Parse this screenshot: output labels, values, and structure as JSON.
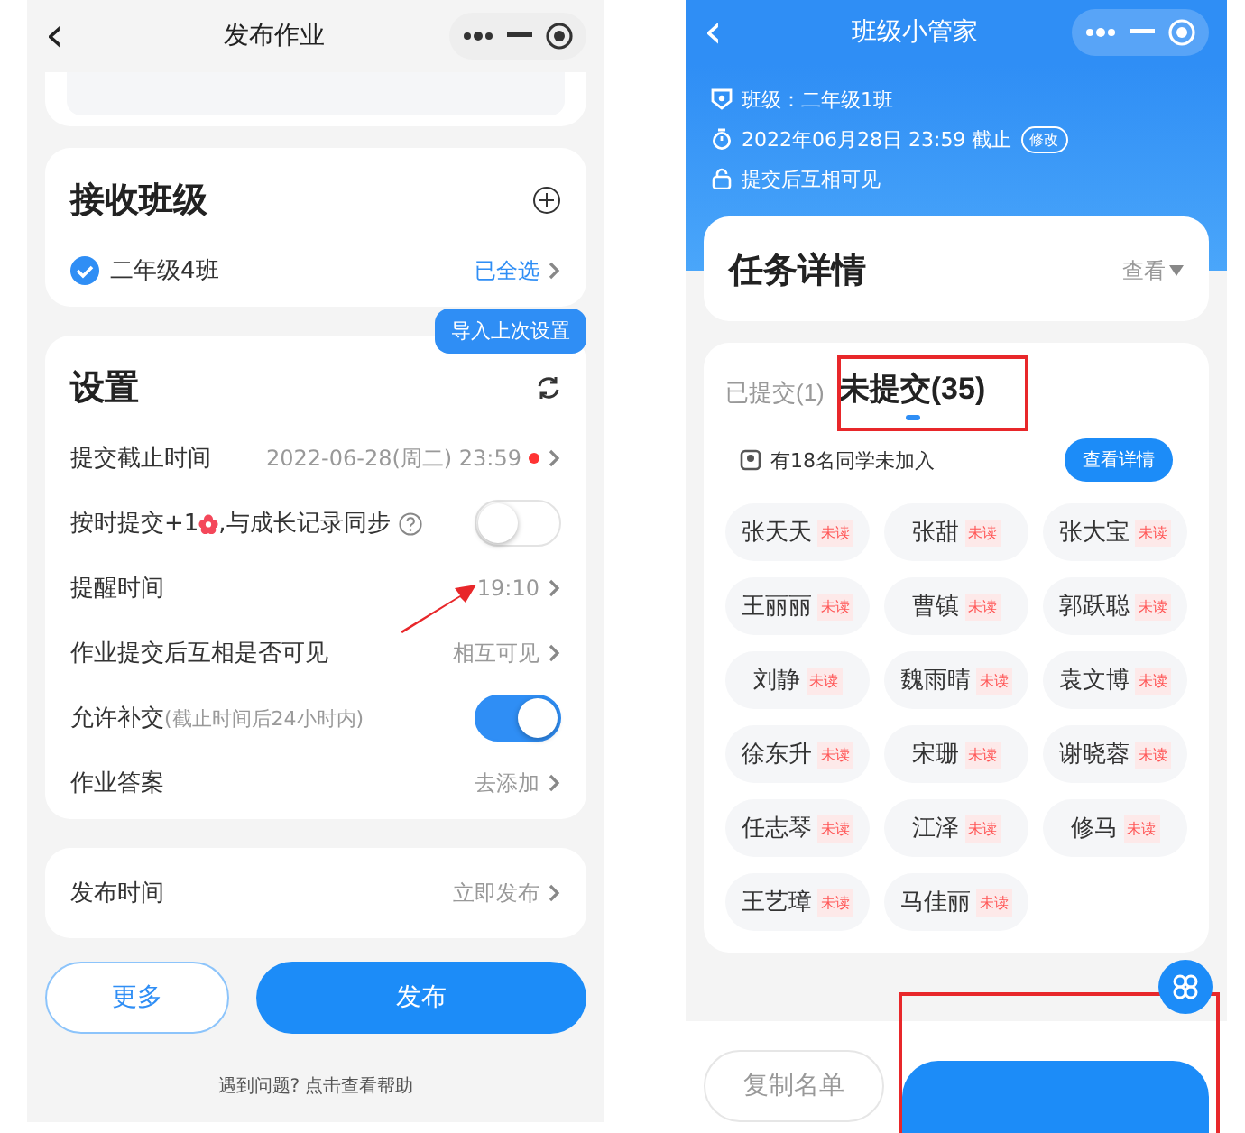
{
  "left": {
    "nav": {
      "title": "发布作业",
      "back": "‹"
    },
    "class_card": {
      "title": "接收班级",
      "class": {
        "name": "二年级4班",
        "checked": true
      },
      "action": "已全选"
    },
    "tooltip": "导入上次设置",
    "settings": {
      "title": "设置",
      "rows": [
        {
          "kind": "value",
          "label": "提交截止时间",
          "value": "2022-06-28(周二) 23:59",
          "alert": true
        },
        {
          "kind": "toggle",
          "label": "按时提交+1",
          "label_after": ",与成长记录同步",
          "help": true,
          "on": false
        },
        {
          "kind": "value",
          "label": "提醒时间",
          "value": "19:10",
          "alert": false
        },
        {
          "kind": "value",
          "label": "作业提交后互相是否可见",
          "value": "相互可见",
          "alert": false
        },
        {
          "kind": "toggle",
          "label": "允许补交",
          "note": "(截止时间后24小时内)",
          "help": false,
          "on": true
        },
        {
          "kind": "value",
          "label": "作业答案",
          "value": "去添加",
          "alert": false
        }
      ]
    },
    "publish_time": {
      "label": "发布时间",
      "value": "立即发布"
    },
    "buttons": {
      "more": "更多",
      "publish": "发布"
    },
    "help": "遇到问题? 点击查看帮助"
  },
  "right": {
    "nav": {
      "title": "班级小管家",
      "back": "‹"
    },
    "info": [
      {
        "kind": "class",
        "text": "班级：二年级1班"
      },
      {
        "kind": "deadline",
        "text": "2022年06月28日 23:59 截止",
        "badge": "修改"
      },
      {
        "kind": "visibility",
        "text": "提交后互相可见"
      }
    ],
    "task_card": {
      "title": "任务详情",
      "action": "查看"
    },
    "tabs": [
      {
        "label": "已提交(1)",
        "selected": false
      },
      {
        "label": "未提交(35)",
        "selected": true
      }
    ],
    "notice": {
      "text": "有18名同学未加入",
      "button": "查看详情"
    },
    "students": [
      {
        "name": "张天天",
        "status": "未读"
      },
      {
        "name": "张甜",
        "status": "未读"
      },
      {
        "name": "张大宝",
        "status": "未读"
      },
      {
        "name": "王丽丽",
        "status": "未读"
      },
      {
        "name": "曹镇",
        "status": "未读"
      },
      {
        "name": "郭跃聪",
        "status": "未读"
      },
      {
        "name": "刘静",
        "status": "未读"
      },
      {
        "name": "魏雨晴",
        "status": "未读"
      },
      {
        "name": "袁文博",
        "status": "未读"
      },
      {
        "name": "徐东升",
        "status": "未读"
      },
      {
        "name": "宋珊",
        "status": "未读"
      },
      {
        "name": "谢晓蓉",
        "status": "未读"
      },
      {
        "name": "任志琴",
        "status": "未读"
      },
      {
        "name": "江泽",
        "status": "未读"
      },
      {
        "name": "修马",
        "status": "未读"
      },
      {
        "name": "王艺璋",
        "status": "未读"
      },
      {
        "name": "马佳丽",
        "status": "未读"
      }
    ],
    "copy_button": "复制名单"
  }
}
